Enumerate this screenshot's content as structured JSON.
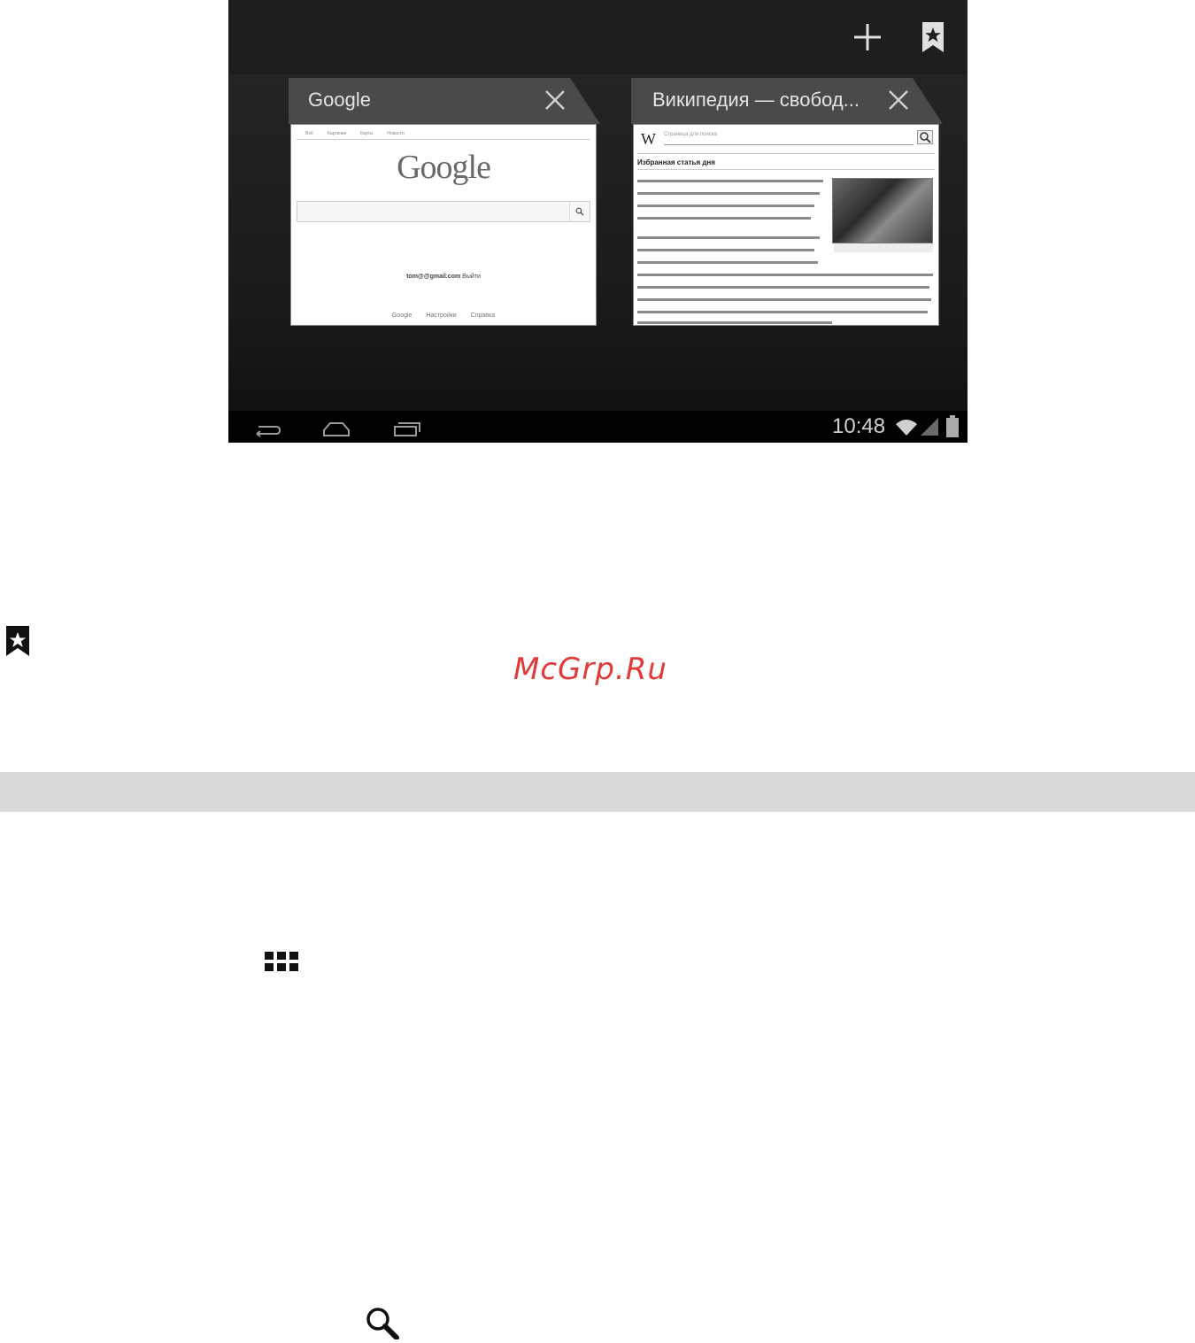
{
  "screenshot": {
    "toolbar": {
      "add_icon": "plus-icon",
      "bookmark_icon": "bookmark-star-icon"
    },
    "tabs": [
      {
        "title": "Google",
        "preview": {
          "nav_tabs": [
            "Веб",
            "Картинки",
            "Карты",
            "Новости"
          ],
          "logo": "Google",
          "account_email": "tom@@gmail.com",
          "sign_out": "Выйти",
          "footer": "Google Настройки Справка"
        }
      },
      {
        "title": "Википедия — свобод...",
        "preview": {
          "logo": "W",
          "search_placeholder": "Страница для поиска",
          "heading": "Избранная статья дня"
        }
      }
    ],
    "status": {
      "time": "10:48"
    }
  },
  "page": {
    "watermark": "McGrp.Ru"
  },
  "colors": {
    "watermark": "#e03a3a",
    "band": "#d9d9d9",
    "screen_bg": "#1b1b1b"
  }
}
